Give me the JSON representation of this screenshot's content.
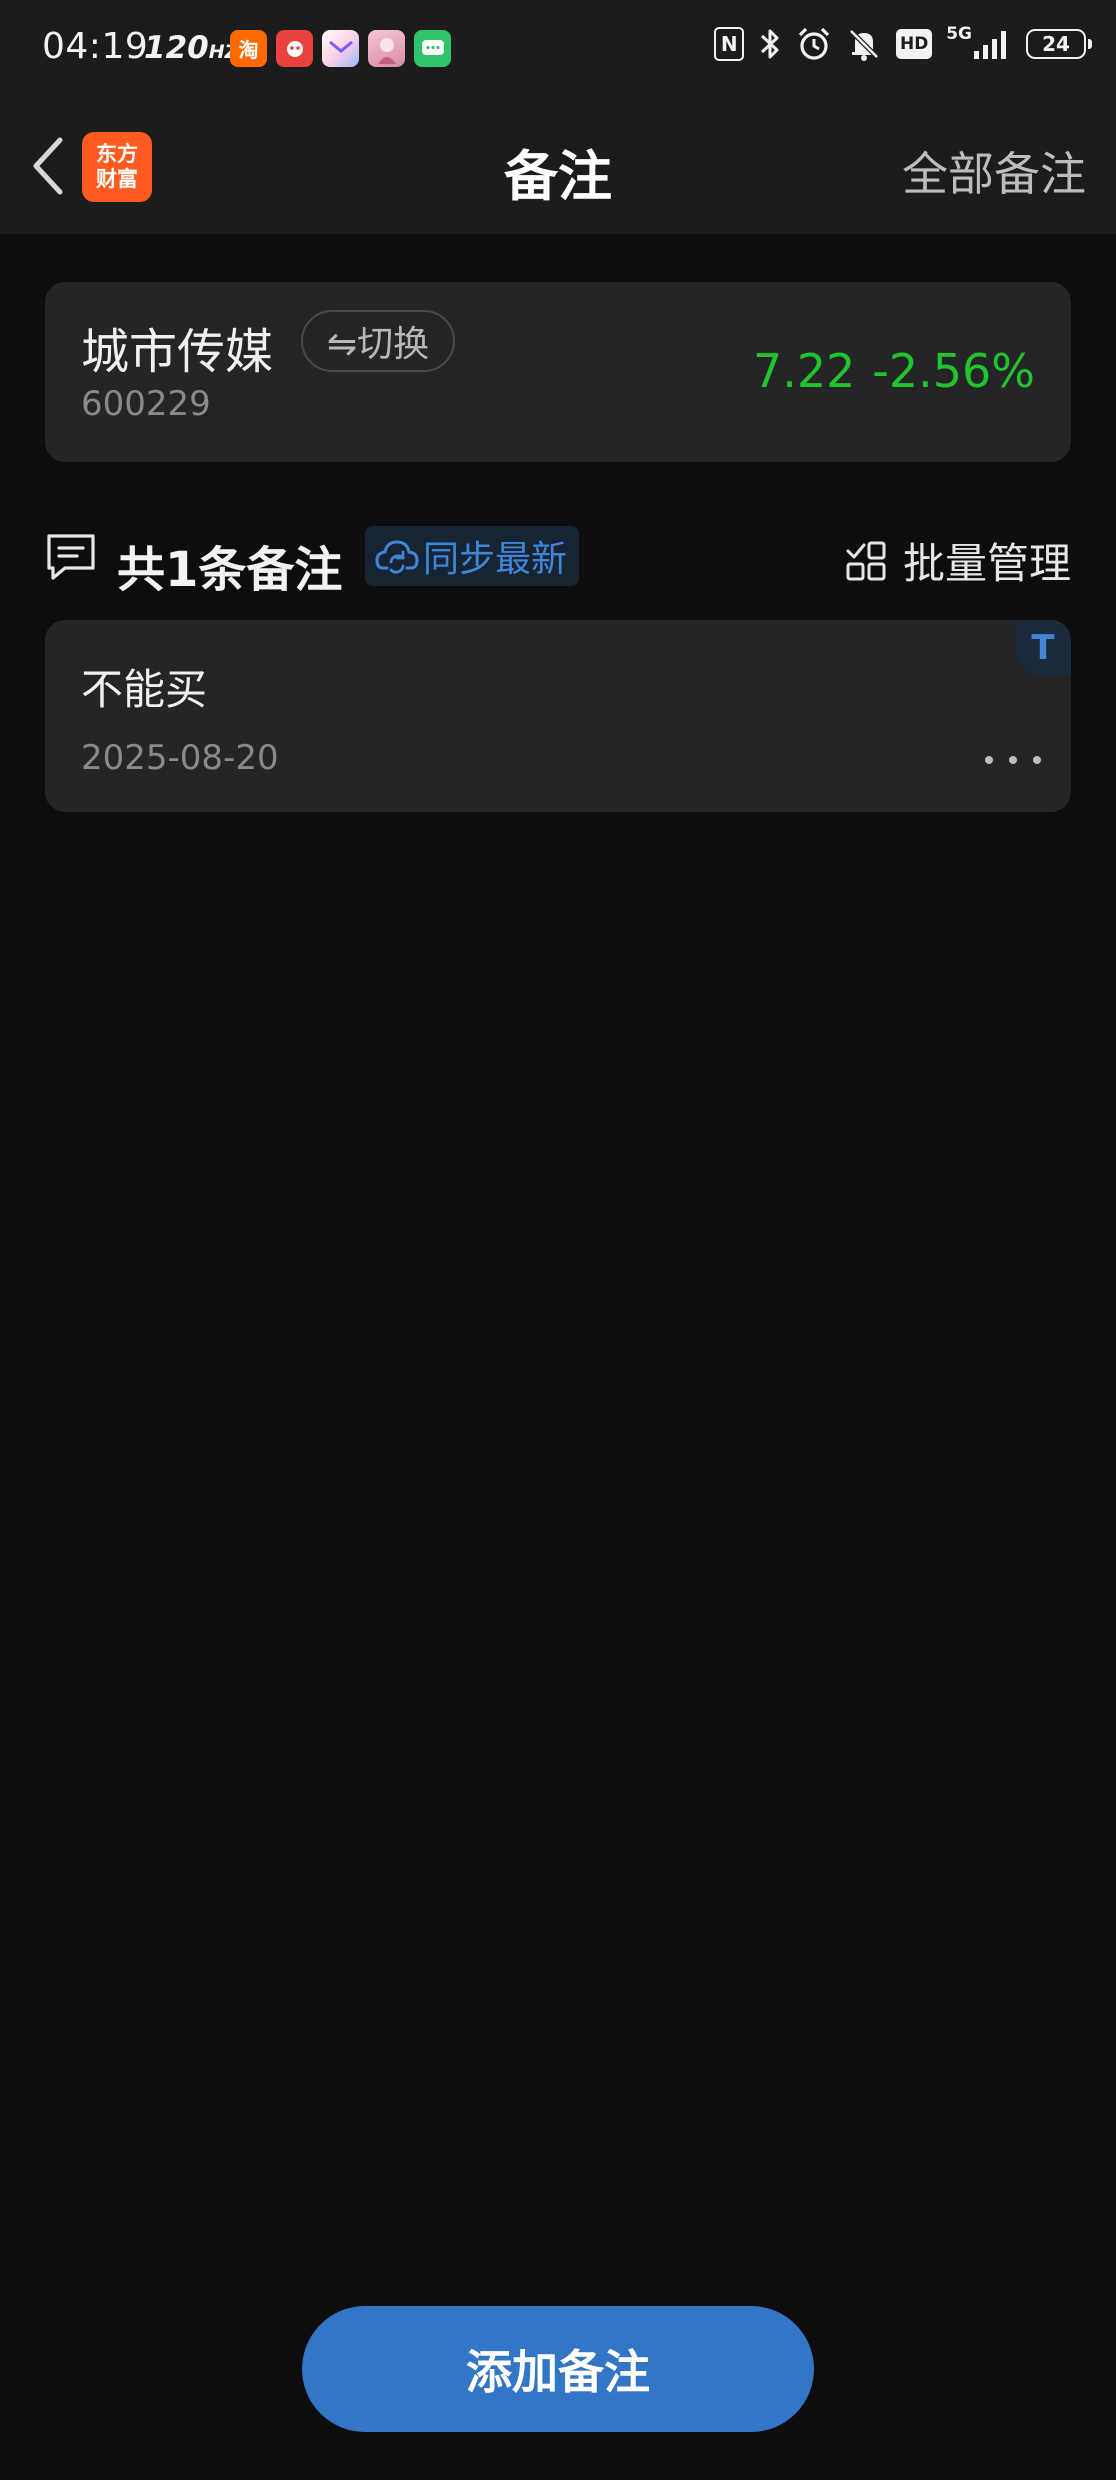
{
  "status_bar": {
    "time": "04:19",
    "refresh_rate": "120",
    "refresh_unit": "HZ",
    "notifications": [
      {
        "name": "taobao-icon",
        "glyph": "淘"
      },
      {
        "name": "xiaohongshu-icon",
        "glyph": ""
      },
      {
        "name": "mail-app-icon",
        "glyph": ""
      },
      {
        "name": "avatar-app-icon",
        "glyph": ""
      },
      {
        "name": "message-app-icon",
        "glyph": ""
      }
    ],
    "nfc": "N",
    "hd": "HD",
    "network": "5G",
    "battery": "24"
  },
  "nav": {
    "app_logo_line1": "东方",
    "app_logo_line2": "财富",
    "title": "备注",
    "all_notes": "全部备注"
  },
  "stock": {
    "name": "城市传媒",
    "code": "600229",
    "switch_label": "⇋切换",
    "price": "7.22",
    "change": "-2.56%",
    "change_color": "#1fc42f"
  },
  "notes_header": {
    "count_label": "共1条备注",
    "sync_label": "同步最新",
    "batch_label": "批量管理"
  },
  "notes": [
    {
      "badge": "T",
      "text": "不能买",
      "date": "2025-08-20"
    }
  ],
  "add_button": "添加备注",
  "colors": {
    "accent": "#3376c8",
    "sync_blue": "#3f86d8",
    "down_green": "#1fc42f",
    "background": "#0d0d0d",
    "card": "#252527"
  }
}
